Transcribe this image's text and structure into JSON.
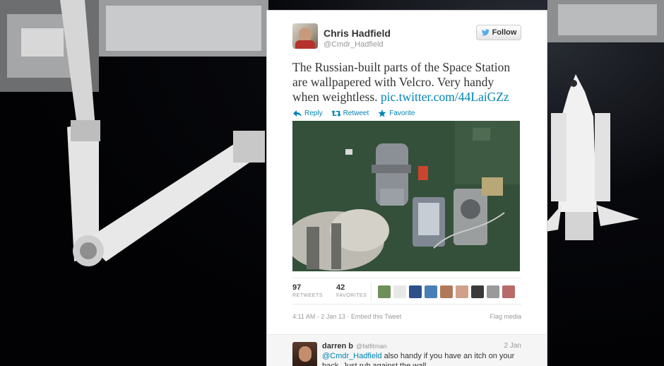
{
  "tweet": {
    "author_name": "Chris Hadfield",
    "author_handle": "@Cmdr_Hadfield",
    "follow_label": "Follow",
    "text": "The Russian-built parts of the Space Station are wallpapered with Velcro. Very handy when weightless. ",
    "link_text": "pic.twitter.com/44LaiGZz",
    "actions": {
      "reply": "Reply",
      "retweet": "Retweet",
      "favorite": "Favorite"
    },
    "stats": {
      "retweets_count": "97",
      "retweets_label": "RETWEETS",
      "favorites_count": "42",
      "favorites_label": "FAVORITES"
    },
    "timestamp": "4:11 AM - 2 Jan 13",
    "embed_label": "Embed this Tweet",
    "flag_label": "Flag media"
  },
  "reply": {
    "name": "darren b",
    "handle": "@fatfitman",
    "date": "2 Jan",
    "mention": "@Cmdr_Hadfield",
    "text": " also handy if you have an itch on your back. Just rub against the wall"
  },
  "colors": {
    "link": "#0084b4",
    "text": "#333333",
    "muted": "#999999"
  },
  "icons": [
    "twitter-bird-icon",
    "reply-icon",
    "retweet-icon",
    "favorite-star-icon"
  ]
}
